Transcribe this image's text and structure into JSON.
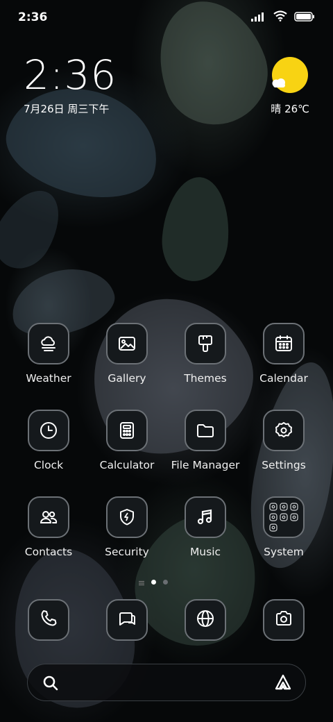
{
  "status_bar": {
    "time": "2:36",
    "icons": [
      "signal-icon",
      "wifi-icon",
      "battery-icon"
    ]
  },
  "clock_widget": {
    "time": "2:36",
    "date": "7月26日 周三下午"
  },
  "weather_widget": {
    "condition_temp": "晴 26℃",
    "icon": "sunny-cloud-icon",
    "sun_color": "#f8d313"
  },
  "apps": [
    {
      "label": "Weather",
      "icon": "weather-icon"
    },
    {
      "label": "Gallery",
      "icon": "gallery-icon"
    },
    {
      "label": "Themes",
      "icon": "brush-icon"
    },
    {
      "label": "Calendar",
      "icon": "calendar-icon"
    },
    {
      "label": "Clock",
      "icon": "clock-icon"
    },
    {
      "label": "Calculator",
      "icon": "calculator-icon"
    },
    {
      "label": "File Manager",
      "icon": "folder-icon"
    },
    {
      "label": "Settings",
      "icon": "gear-icon"
    },
    {
      "label": "Contacts",
      "icon": "contacts-icon"
    },
    {
      "label": "Security",
      "icon": "shield-icon"
    },
    {
      "label": "Music",
      "icon": "music-note-icon"
    },
    {
      "label": "System",
      "icon": "folder-grid-icon"
    }
  ],
  "page_indicator": {
    "pages": 2,
    "active": 1
  },
  "dock": [
    {
      "icon": "phone-icon"
    },
    {
      "icon": "messages-icon"
    },
    {
      "icon": "browser-globe-icon"
    },
    {
      "icon": "camera-icon"
    }
  ],
  "search_bar": {
    "left_icon": "search-icon",
    "right_icon": "assistant-icon"
  }
}
